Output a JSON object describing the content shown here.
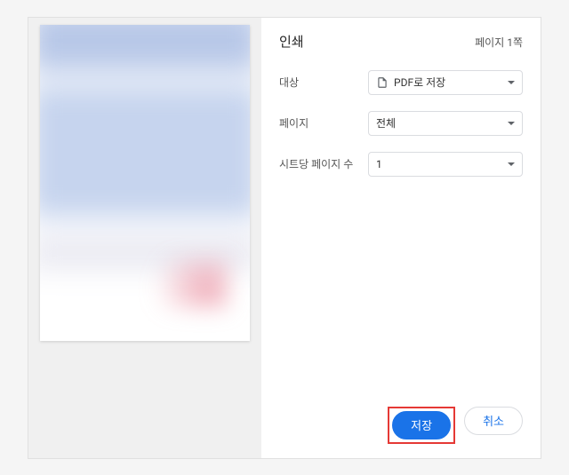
{
  "header": {
    "title": "인쇄",
    "page_count": "페이지 1쪽"
  },
  "options": {
    "destination": {
      "label": "대상",
      "value": "PDF로 저장"
    },
    "pages": {
      "label": "페이지",
      "value": "전체"
    },
    "pages_per_sheet": {
      "label": "시트당 페이지 수",
      "value": "1"
    }
  },
  "footer": {
    "save": "저장",
    "cancel": "취소"
  }
}
